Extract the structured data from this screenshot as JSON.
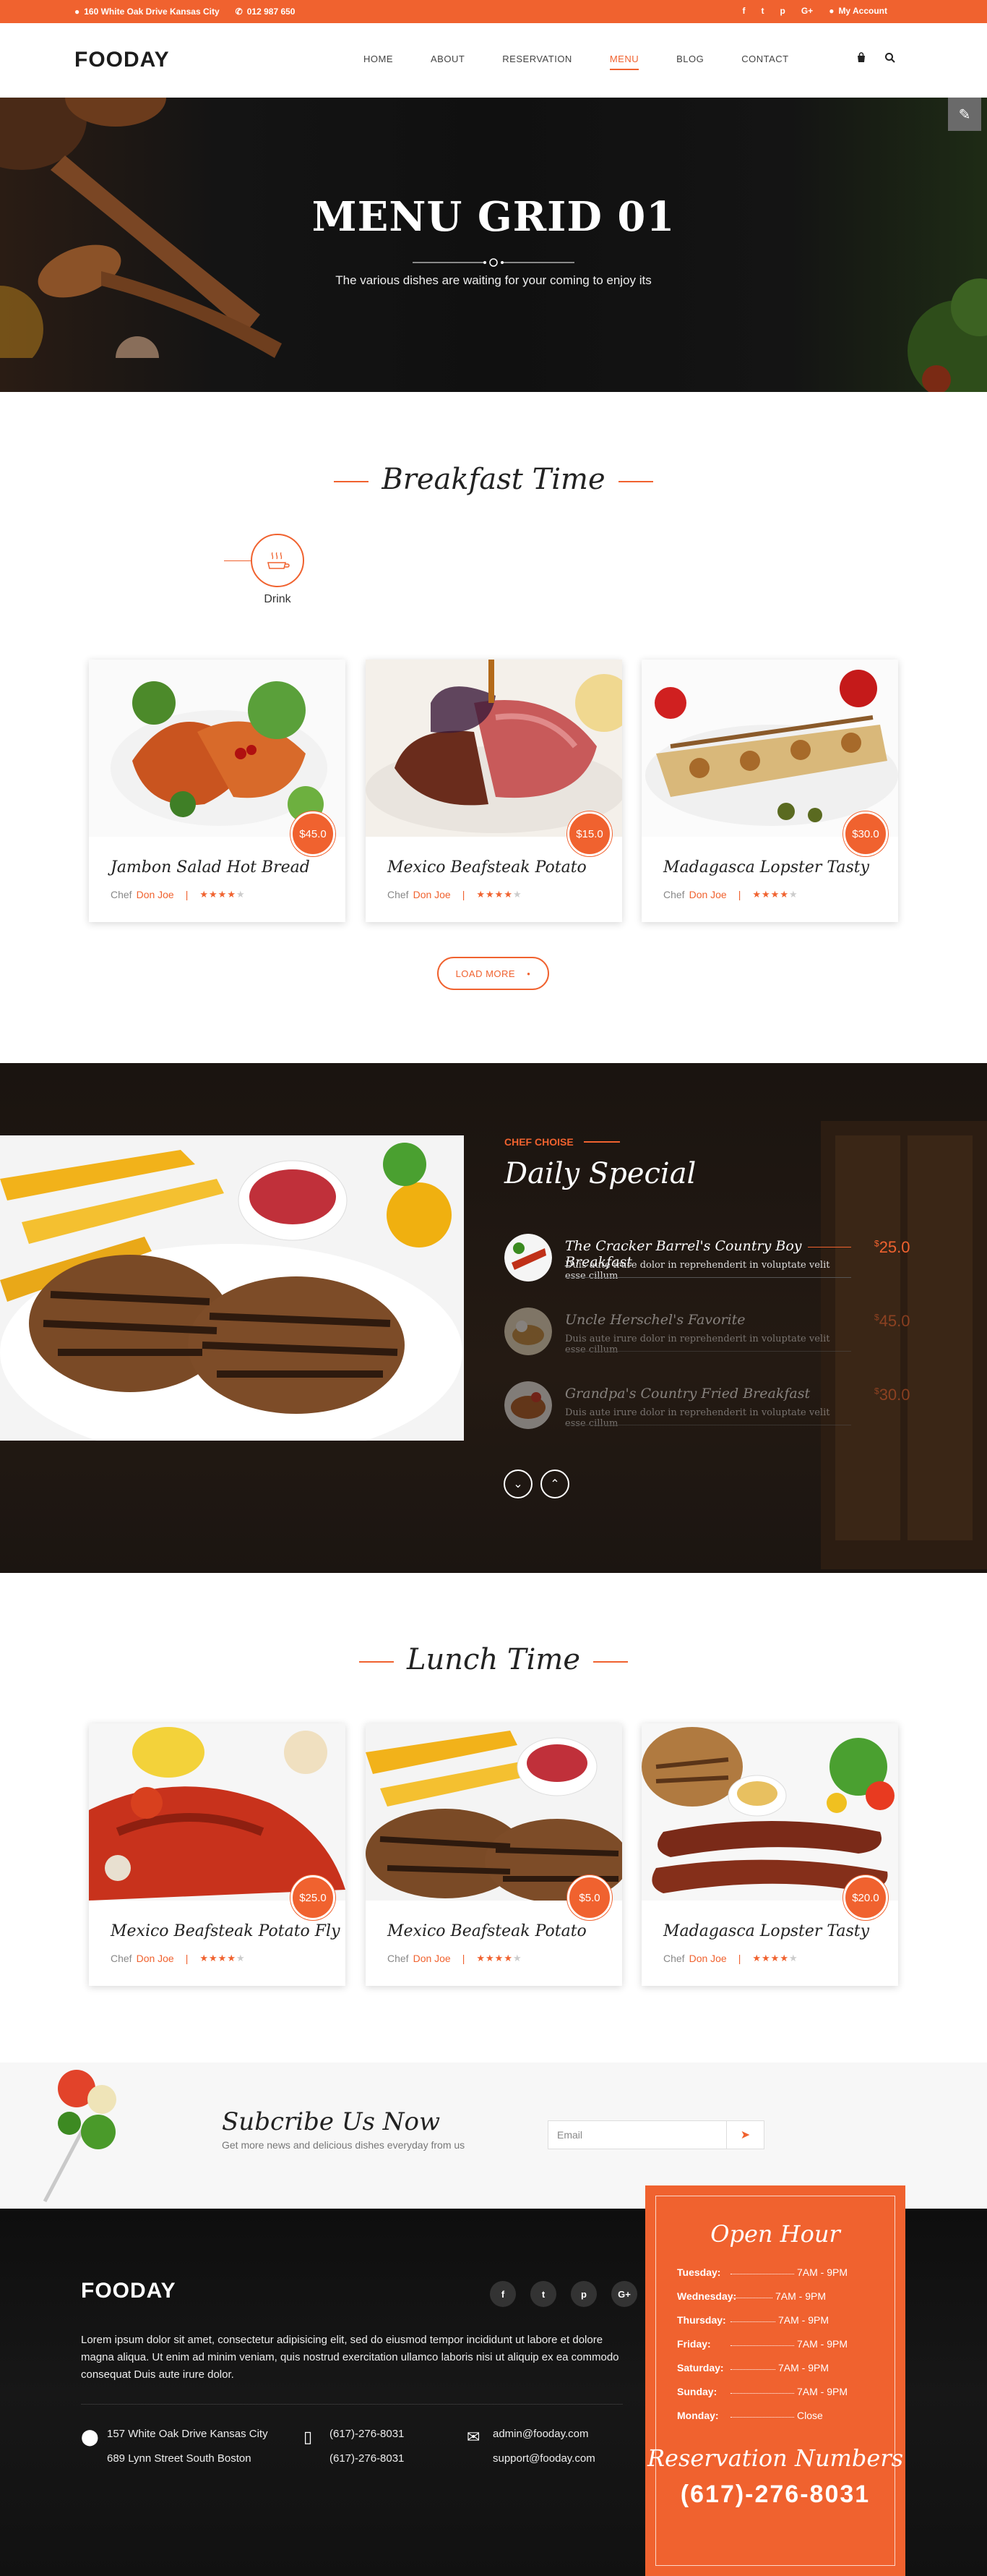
{
  "topbar": {
    "address": "160 White Oak Drive Kansas City",
    "phone": "012 987 650",
    "social": [
      "f",
      "t",
      "p",
      "G+"
    ],
    "account": "My Account"
  },
  "header": {
    "logo": "FOODAY",
    "nav": [
      "HOME",
      "ABOUT",
      "RESERVATION",
      "MENU",
      "BLOG",
      "CONTACT"
    ],
    "active_nav": "MENU",
    "icons": [
      "cart-icon",
      "search-icon"
    ]
  },
  "hero": {
    "title": "MENU GRID 01",
    "subtitle": "The various dishes are waiting for your coming to enjoy its"
  },
  "breakfast": {
    "title": "Breakfast Time",
    "category": "Drink",
    "load_more": "LOAD MORE",
    "items": [
      {
        "name": "Jambon Salad Hot Bread",
        "price": "$45.0",
        "chef_label": "Chef",
        "chef": "Don Joe",
        "rating": 4
      },
      {
        "name": "Mexico Beafsteak Potato",
        "price": "$15.0",
        "chef_label": "Chef",
        "chef": "Don Joe",
        "rating": 4
      },
      {
        "name": "Madagasca Lopster Tasty",
        "price": "$30.0",
        "chef_label": "Chef",
        "chef": "Don Joe",
        "rating": 4
      }
    ]
  },
  "special": {
    "kicker": "CHEF CHOISE",
    "title": "Daily Special",
    "items": [
      {
        "name": "The Cracker Barrel's Country Boy Breakfast",
        "desc": "Duis aute irure dolor in reprehenderit in voluptate velit esse cillum",
        "price_sym": "$",
        "price": "25.0"
      },
      {
        "name": "Uncle Herschel's Favorite",
        "desc": "Duis aute irure dolor in reprehenderit in voluptate velit esse cillum",
        "price_sym": "$",
        "price": "45.0"
      },
      {
        "name": "Grandpa's Country Fried Breakfast",
        "desc": "Duis aute irure dolor in reprehenderit in voluptate velit esse cillum",
        "price_sym": "$",
        "price": "30.0"
      }
    ]
  },
  "lunch": {
    "title": "Lunch Time",
    "items": [
      {
        "name": "Mexico Beafsteak Potato Fly",
        "price": "$25.0",
        "chef_label": "Chef",
        "chef": "Don Joe",
        "rating": 4
      },
      {
        "name": "Mexico Beafsteak Potato",
        "price": "$5.0",
        "chef_label": "Chef",
        "chef": "Don Joe",
        "rating": 4
      },
      {
        "name": "Madagasca Lopster Tasty",
        "price": "$20.0",
        "chef_label": "Chef",
        "chef": "Don Joe",
        "rating": 4
      }
    ]
  },
  "subscribe": {
    "title": "Subcribe Us Now",
    "text": "Get more news and delicious dishes everyday from us",
    "placeholder": "Email"
  },
  "footer": {
    "logo": "FOODAY",
    "social": [
      "f",
      "t",
      "p",
      "G+"
    ],
    "text": "Lorem ipsum dolor sit amet, consectetur adipisicing elit, sed do eiusmod tempor incididunt ut labore et dolore magna aliqua. Ut enim ad minim veniam, quis nostrud exercitation ullamco laboris nisi ut aliquip ex ea commodo consequat Duis aute irure dolor.",
    "address1": "157 White Oak Drive Kansas City",
    "address2": "689 Lynn Street South Boston",
    "phone1": "(617)-276-8031",
    "phone2": "(617)-276-8031",
    "email1": "admin@fooday.com",
    "email2": "support@fooday.com"
  },
  "hours": {
    "title": "Open Hour",
    "rows": [
      {
        "day": "Tuesday:",
        "time": "7AM - 9PM"
      },
      {
        "day": "Wednesday:",
        "time": "7AM - 9PM"
      },
      {
        "day": "Thursday:",
        "time": "7AM - 9PM"
      },
      {
        "day": "Friday:",
        "time": "7AM - 9PM"
      },
      {
        "day": "Saturday:",
        "time": "7AM - 9PM"
      },
      {
        "day": "Sunday:",
        "time": "7AM - 9PM"
      },
      {
        "day": "Monday:",
        "time": "Close"
      }
    ],
    "reservation_title": "Reservation Numbers",
    "reservation_phone": "(617)-276-8031"
  },
  "colors": {
    "accent": "#f0622f",
    "dark": "#141414"
  }
}
